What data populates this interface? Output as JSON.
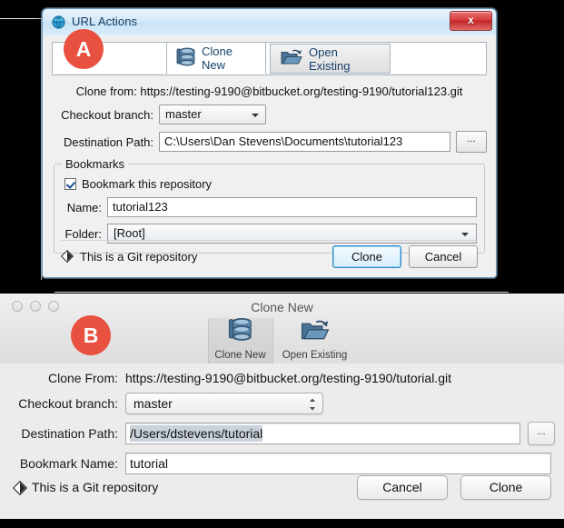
{
  "annotations": [
    {
      "id": "A",
      "label": "A"
    },
    {
      "id": "B",
      "label": "B"
    }
  ],
  "windows_dialog": {
    "title": "URL Actions",
    "title_icon": "globe-icon",
    "close_label": "x",
    "tabs": [
      {
        "label": "Clone New",
        "icon": "database-stack-icon",
        "active": true
      },
      {
        "label": "Open Existing",
        "icon": "open-folder-icon",
        "active": false
      }
    ],
    "clone_from_label": "Clone from:",
    "clone_from_value": "https://testing-9190@bitbucket.org/testing-9190/tutorial123.git",
    "checkout_branch_label": "Checkout branch:",
    "checkout_branch_value": "master",
    "destination_path_label": "Destination Path:",
    "destination_path_value": "C:\\Users\\Dan Stevens\\Documents\\tutorial123",
    "browse_label": "...",
    "bookmarks_group_label": "Bookmarks",
    "bookmark_checkbox_label": "Bookmark this repository",
    "bookmark_checked": true,
    "name_label": "Name:",
    "name_value": "tutorial123",
    "folder_label": "Folder:",
    "folder_value": "[Root]",
    "footer_text": "This is a Git repository",
    "footer_icon": "git-diamond-icon",
    "primary_button": "Clone",
    "secondary_button": "Cancel"
  },
  "mac_dialog": {
    "title": "Clone New",
    "traffic_lights": [
      "close-button",
      "minimize-button",
      "zoom-button"
    ],
    "tabs": [
      {
        "label": "Clone New",
        "icon": "database-stack-icon",
        "active": true
      },
      {
        "label": "Open Existing",
        "icon": "open-folder-icon",
        "active": false
      }
    ],
    "clone_from_label": "Clone From:",
    "clone_from_value": "https://testing-9190@bitbucket.org/testing-9190/tutorial.git",
    "checkout_branch_label": "Checkout branch:",
    "checkout_branch_value": "master",
    "destination_path_label": "Destination Path:",
    "destination_path_value": "/Users/dstevens/tutorial",
    "browse_label": "...",
    "bookmark_name_label": "Bookmark Name:",
    "bookmark_name_value": "tutorial",
    "footer_text": "This is a Git repository",
    "footer_icon": "git-diamond-icon",
    "primary_button": "Clone",
    "secondary_button": "Cancel"
  },
  "colors": {
    "badge": "#e8503f",
    "windows_titlebar": "#cde4f6",
    "windows_close": "#d63b3b",
    "mac_chrome": "#ececec",
    "default_button_accent": "#2f89c4"
  }
}
